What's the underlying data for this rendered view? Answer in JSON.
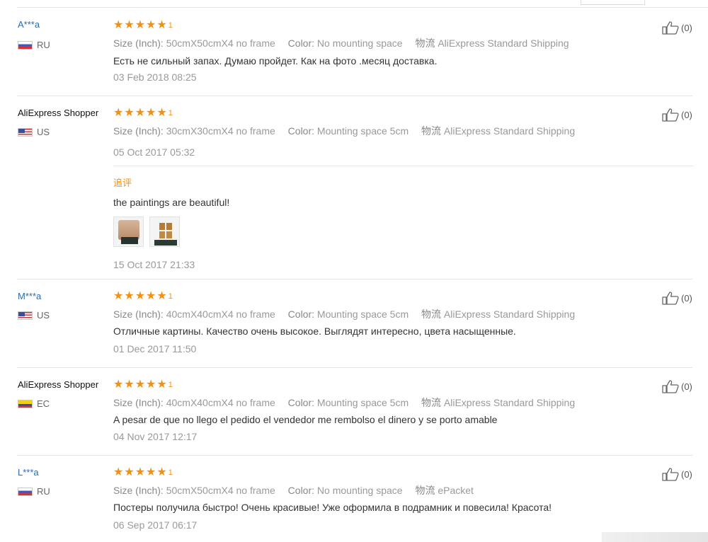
{
  "labels": {
    "size": "Size (Inch):",
    "color": "Color:",
    "shipping": "物流"
  },
  "reviews": [
    {
      "name": "A***a",
      "country": "RU",
      "stars": 5,
      "star_count": "1",
      "size": "50cmX50cmX4 no frame",
      "color": "No mounting space",
      "shipping": "AliExpress Standard Shipping",
      "text": "Есть не сильный запах. Думаю пройдет. Как на фото .месяц доставка.",
      "date": "03 Feb 2018 08:25",
      "likes": "(0)"
    },
    {
      "name": "AliExpress Shopper",
      "country": "US",
      "stars": 5,
      "star_count": "1",
      "size": "30cmX30cmX4 no frame",
      "color": "Mounting space 5cm",
      "shipping": "AliExpress Standard Shipping",
      "date": "05 Oct 2017 05:32",
      "likes": "(0)",
      "followup": {
        "label": "追评",
        "text": "the paintings are beautiful!",
        "date": "15 Oct 2017 21:33"
      }
    },
    {
      "name": "M***a",
      "country": "US",
      "stars": 5,
      "star_count": "1",
      "size": "40cmX40cmX4 no frame",
      "color": "Mounting space 5cm",
      "shipping": "AliExpress Standard Shipping",
      "text": "Отличные картины. Качество очень высокое. Выглядят интересно, цвета насыщенные.",
      "date": "01 Dec 2017 11:50",
      "likes": "(0)"
    },
    {
      "name": "AliExpress Shopper",
      "country": "EC",
      "stars": 5,
      "star_count": "1",
      "size": "40cmX40cmX4 no frame",
      "color": "Mounting space 5cm",
      "shipping": "AliExpress Standard Shipping",
      "text": "A pesar de que no llego el pedido el vendedor me rembolso el dinero y se porto amable",
      "date": "04 Nov 2017 12:17",
      "likes": "(0)"
    },
    {
      "name": "L***a",
      "country": "RU",
      "stars": 5,
      "star_count": "1",
      "size": "50cmX50cmX4 no frame",
      "color": "No mounting space",
      "shipping": "ePacket",
      "text": "Постеры получила быстро! Очень красивые! Уже оформила в подрамник и повесила! Красота!",
      "date": "06 Sep 2017 06:17",
      "likes": "(0)"
    }
  ],
  "colors": {
    "star": "#f58f12",
    "masked_name": "#2b6cb0",
    "meta": "#999999"
  },
  "icons": {
    "like": "thumbs-up-icon",
    "star": "star-icon"
  }
}
